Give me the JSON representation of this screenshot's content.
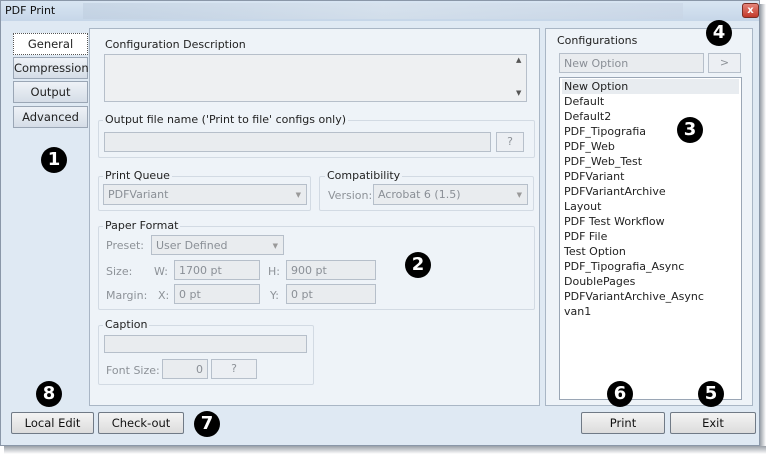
{
  "window": {
    "title": "PDF Print",
    "close_label": "x"
  },
  "tabs": [
    {
      "label": "General",
      "active": true
    },
    {
      "label": "Compression",
      "active": false
    },
    {
      "label": "Output",
      "active": false
    },
    {
      "label": "Advanced",
      "active": false
    }
  ],
  "general": {
    "config_description": {
      "label": "Configuration Description",
      "value": ""
    },
    "output_file": {
      "label": "Output file name ('Print to file' configs only)",
      "value": "",
      "browse_label": "?"
    },
    "print_queue": {
      "label": "Print Queue",
      "value": "PDFVariant"
    },
    "compatibility": {
      "label": "Compatibility",
      "version_label": "Version:",
      "value": "Acrobat 6 (1.5)"
    },
    "paper_format": {
      "label": "Paper Format",
      "preset_label": "Preset:",
      "preset_value": "User Defined",
      "size_label": "Size:",
      "w_label": "W:",
      "w_value": "1700 pt",
      "h_label": "H:",
      "h_value": "900 pt",
      "margin_label": "Margin:",
      "x_label": "X:",
      "x_value": "0 pt",
      "y_label": "Y:",
      "y_value": "0 pt"
    },
    "caption": {
      "label": "Caption",
      "value": "",
      "font_size_label": "Font Size:",
      "font_size_value": "0",
      "help_label": "?"
    }
  },
  "configurations": {
    "label": "Configurations",
    "new_name_value": "New Option",
    "add_button_label": ">",
    "items": [
      "New Option",
      "Default",
      "Default2",
      "PDF_Tipografia",
      "PDF_Web",
      "PDF_Web_Test",
      "PDFVariant",
      "PDFVariantArchive",
      "Layout",
      "PDF Test Workflow",
      "PDF File",
      "Test Option",
      "PDF_Tipografia_Async",
      "DoublePages",
      "PDFVariantArchive_Async",
      "van1"
    ],
    "selected_index": 0
  },
  "buttons": {
    "local_edit": "Local Edit",
    "check_out": "Check-out",
    "print": "Print",
    "exit": "Exit"
  },
  "badges": [
    "1",
    "2",
    "3",
    "4",
    "5",
    "6",
    "7",
    "8"
  ]
}
